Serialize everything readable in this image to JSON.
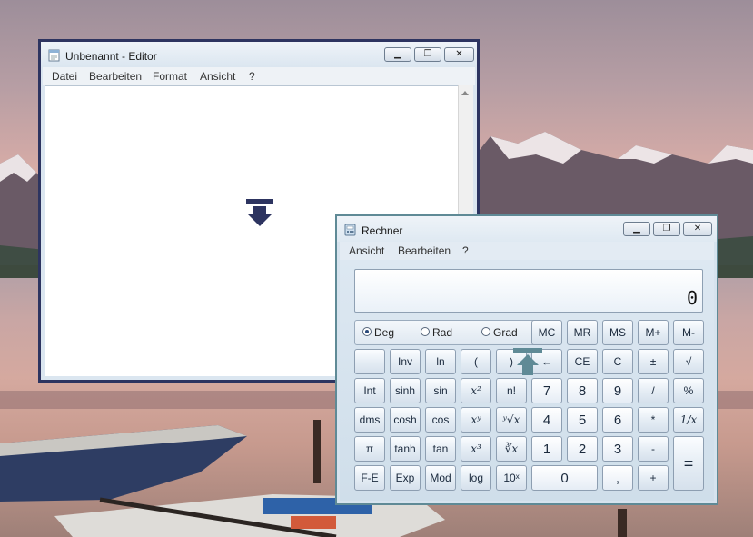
{
  "colors": {
    "editor_frame": "#2d3460",
    "calc_frame": "#5f8a96",
    "snap_indicator_dark": "#2d3460",
    "snap_indicator_teal": "#5f8a96"
  },
  "editor": {
    "title": "Unbenannt - Editor",
    "icon": "notepad-icon",
    "menu": [
      "Datei",
      "Bearbeiten",
      "Format",
      "Ansicht",
      "?"
    ],
    "text_content": ""
  },
  "calculator": {
    "title": "Rechner",
    "icon": "calculator-icon",
    "menu": [
      "Ansicht",
      "Bearbeiten",
      "?"
    ],
    "display": "0",
    "angle_units": [
      {
        "label": "Deg",
        "selected": true
      },
      {
        "label": "Rad",
        "selected": false
      },
      {
        "label": "Grad",
        "selected": false
      }
    ],
    "memory_keys": [
      "MC",
      "MR",
      "MS",
      "M+",
      "M-"
    ],
    "keys": {
      "blank": "",
      "inv": "Inv",
      "ln": "ln",
      "paren_open": "(",
      "paren_close": ")",
      "backspace": "←",
      "ce": "CE",
      "c": "C",
      "plusminus": "±",
      "sqrt": "√",
      "int": "Int",
      "sinh": "sinh",
      "sin": "sin",
      "x2": "x²",
      "nfact": "n!",
      "n7": "7",
      "n8": "8",
      "n9": "9",
      "div": "/",
      "pct": "%",
      "dms": "dms",
      "cosh": "cosh",
      "cos": "cos",
      "xy": "xʸ",
      "yroot": "ʸ√x",
      "n4": "4",
      "n5": "5",
      "n6": "6",
      "mul": "*",
      "recip": "1/x",
      "pi": "π",
      "tanh": "tanh",
      "tan": "tan",
      "x3": "x³",
      "cuberoot": "∛x",
      "n1": "1",
      "n2": "2",
      "n3": "3",
      "minus": "-",
      "equals": "=",
      "fe": "F-E",
      "exp": "Exp",
      "mod": "Mod",
      "log": "log",
      "tenx": "10ˣ",
      "n0": "0",
      "comma": ",",
      "plus": "+"
    }
  }
}
